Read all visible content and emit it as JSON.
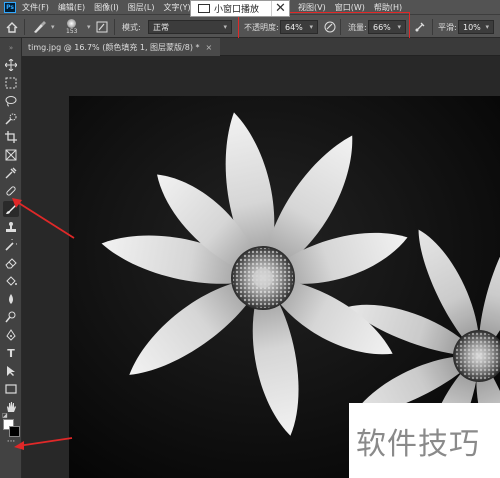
{
  "app": {
    "logo": "Ps"
  },
  "menu": {
    "items": [
      "文件(F)",
      "编辑(E)",
      "图像(I)",
      "图层(L)",
      "文字(Y)"
    ],
    "right_items": [
      "视图(V)",
      "窗口(W)",
      "帮助(H)"
    ]
  },
  "pip_popup": {
    "label": "小窗口播放",
    "close": "✕"
  },
  "options": {
    "brush_size": "153",
    "mode_label": "模式:",
    "mode_value": "正常",
    "opacity_label": "不透明度:",
    "opacity_value": "64%",
    "flow_label": "流量:",
    "flow_value": "66%",
    "smoothing_label": "平滑:",
    "smoothing_value": "10%"
  },
  "document": {
    "tab_title": "timg.jpg @ 16.7% (颜色填充 1, 图层蒙版/8) *",
    "tab_close": "×"
  },
  "colors": {
    "foreground": "#ffffff",
    "background": "#000000",
    "annotation": "#e02828"
  },
  "watermark": {
    "text": "软件技巧"
  }
}
